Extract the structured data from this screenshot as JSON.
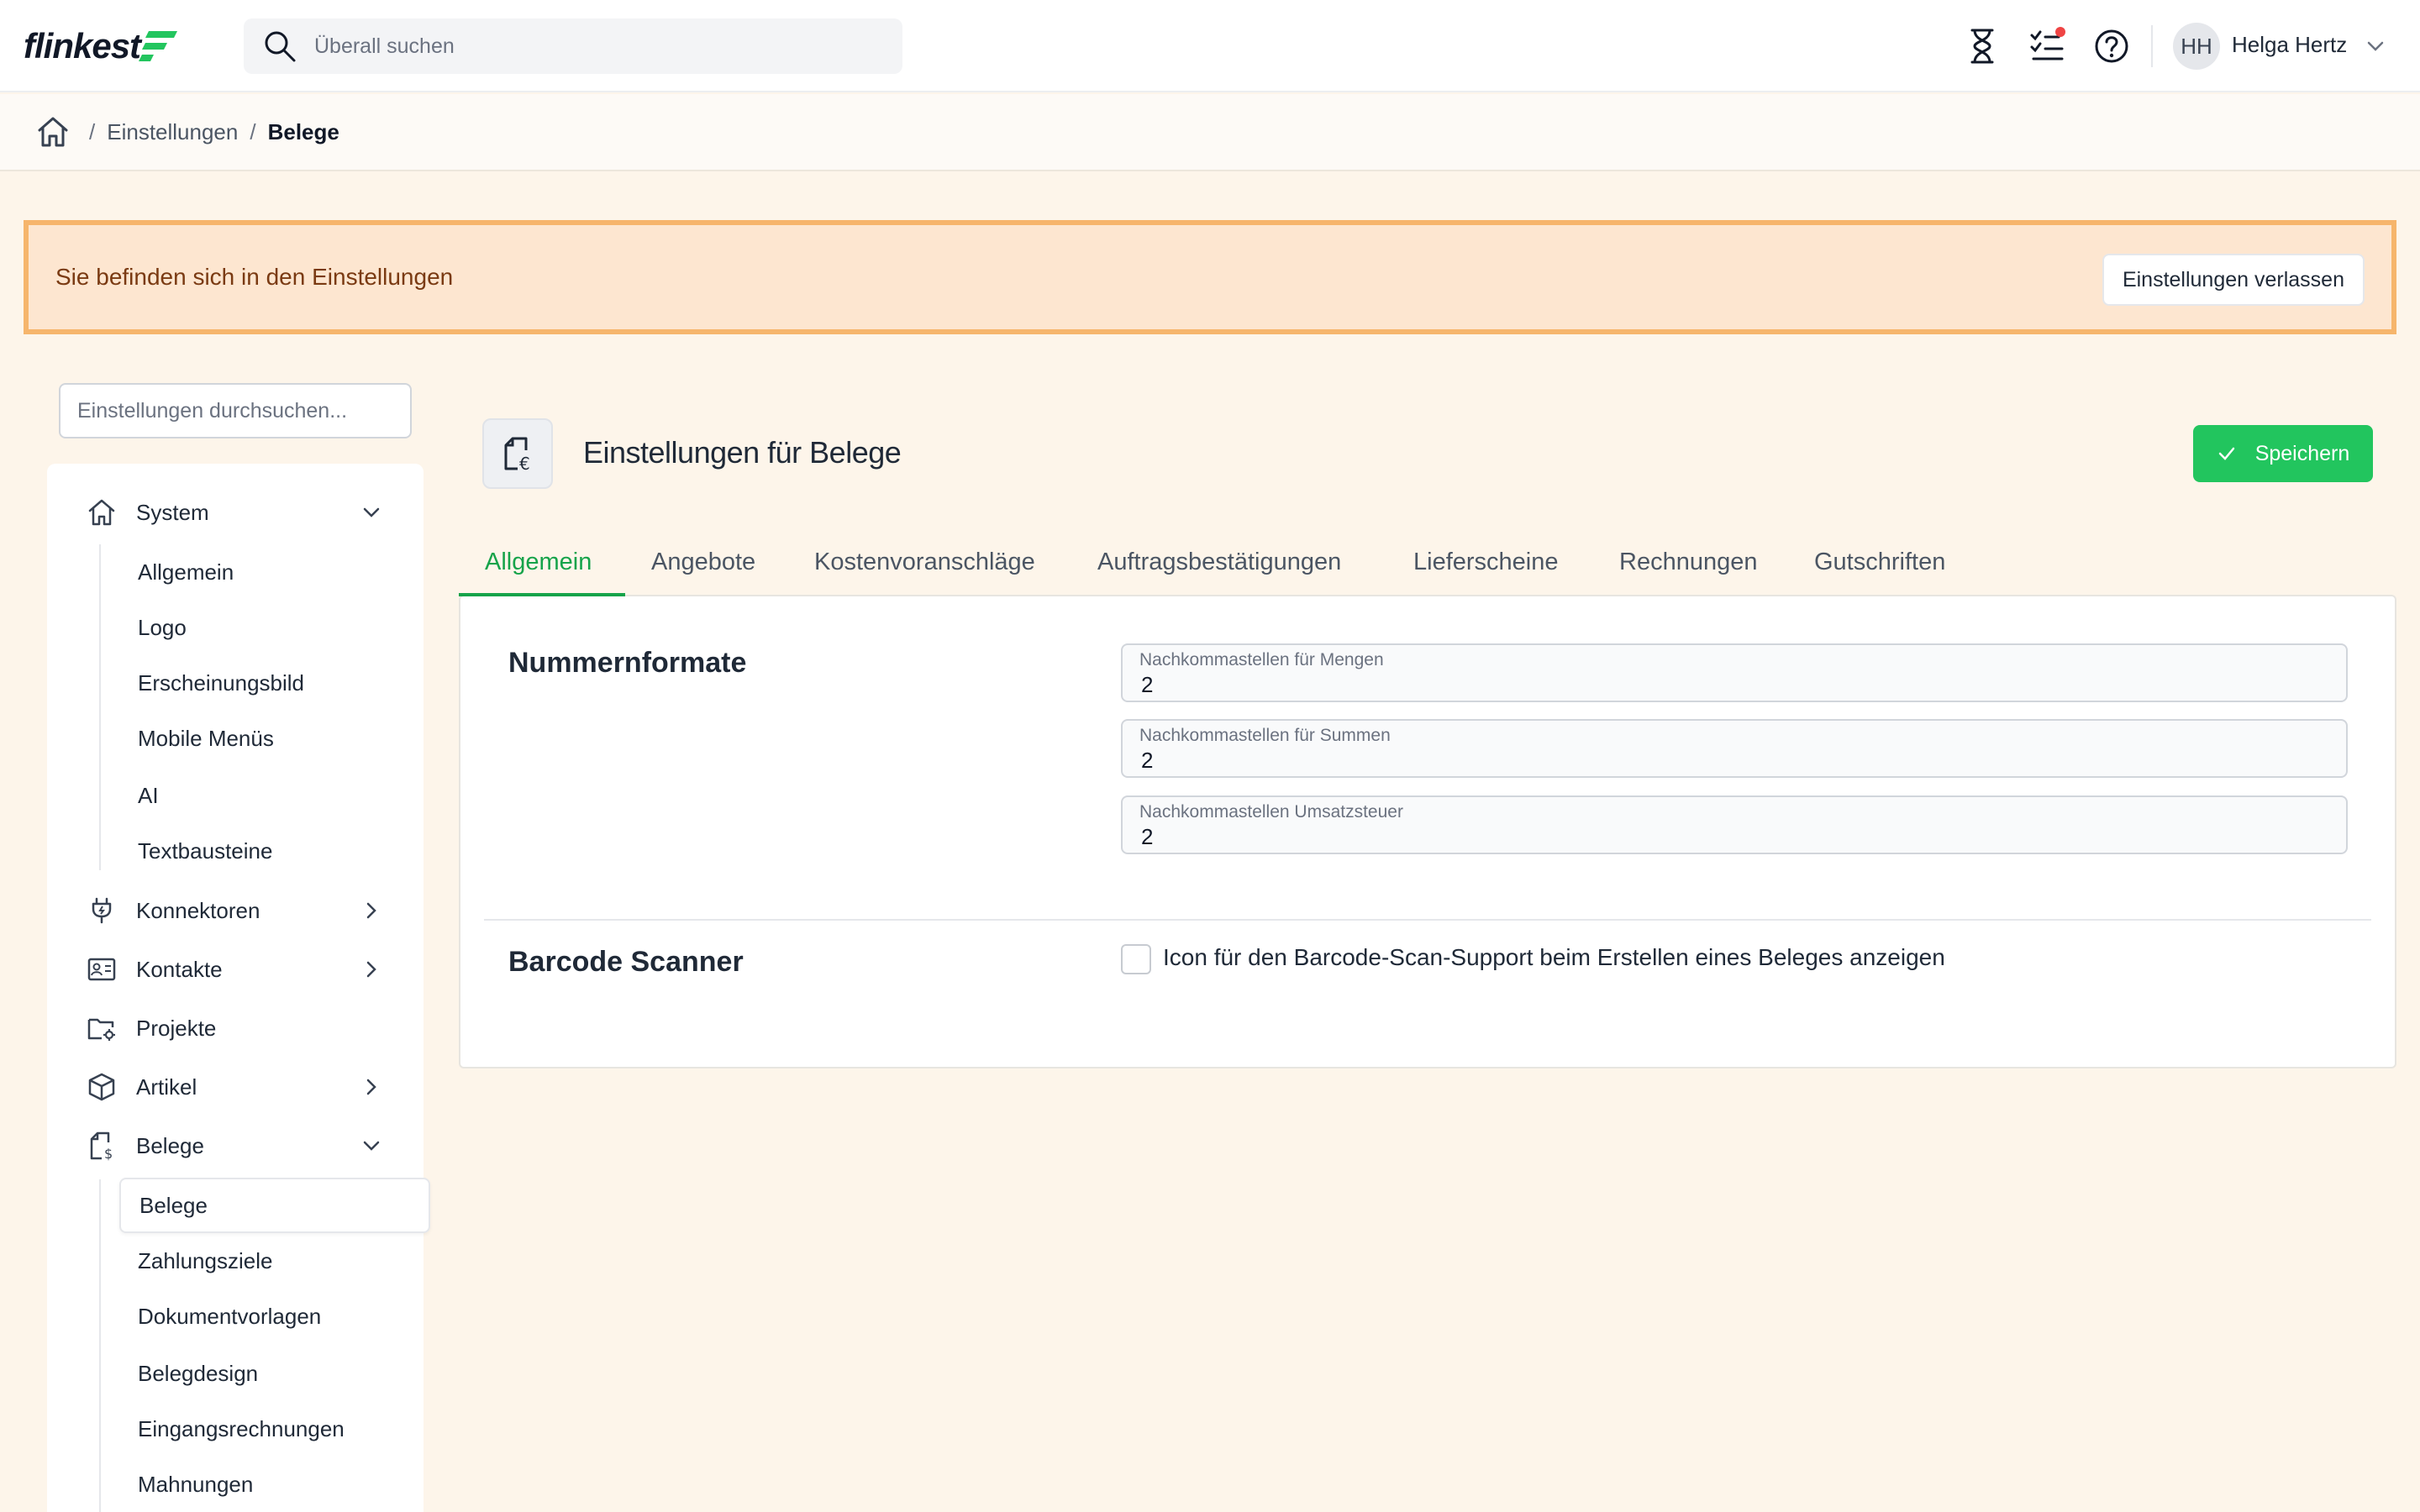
{
  "header": {
    "logo_text": "flinkest",
    "search_placeholder": "Überall suchen",
    "user_initials": "HH",
    "user_name": "Helga Hertz"
  },
  "breadcrumb": {
    "items": [
      "Einstellungen",
      "Belege"
    ]
  },
  "banner": {
    "text": "Sie befinden sich in den Einstellungen",
    "button": "Einstellungen verlassen"
  },
  "sidebar": {
    "search_placeholder": "Einstellungen durchsuchen...",
    "system": {
      "label": "System",
      "children": [
        "Allgemein",
        "Logo",
        "Erscheinungsbild",
        "Mobile Menüs",
        "AI",
        "Textbausteine"
      ]
    },
    "konnektoren": "Konnektoren",
    "kontakte": "Kontakte",
    "projekte": "Projekte",
    "artikel": "Artikel",
    "belege": {
      "label": "Belege",
      "children": [
        "Belege",
        "Zahlungsziele",
        "Dokumentvorlagen",
        "Belegdesign",
        "Eingangsrechnungen",
        "Mahnungen"
      ]
    }
  },
  "main": {
    "title": "Einstellungen für Belege",
    "save_label": "Speichern",
    "tabs": [
      "Allgemein",
      "Angebote",
      "Kostenvoranschläge",
      "Auftragsbestätigungen",
      "Lieferscheine",
      "Rechnungen",
      "Gutschriften"
    ],
    "active_tab": "Allgemein",
    "sections": {
      "nummernformate": {
        "title": "Nummernformate",
        "fields": [
          {
            "label": "Nachkommastellen für Mengen",
            "value": "2"
          },
          {
            "label": "Nachkommastellen für Summen",
            "value": "2"
          },
          {
            "label": "Nachkommastellen Umsatzsteuer",
            "value": "2"
          }
        ]
      },
      "barcode": {
        "title": "Barcode Scanner",
        "checkbox_label": "Icon für den Barcode-Scan-Support beim Erstellen eines Beleges anzeigen",
        "checked": false
      }
    }
  },
  "colors": {
    "accent_green": "#16a34a",
    "button_green": "#22c55e",
    "banner_border": "#f6b56c",
    "banner_bg": "#fde6d0",
    "notification_dot": "#ef4444"
  }
}
